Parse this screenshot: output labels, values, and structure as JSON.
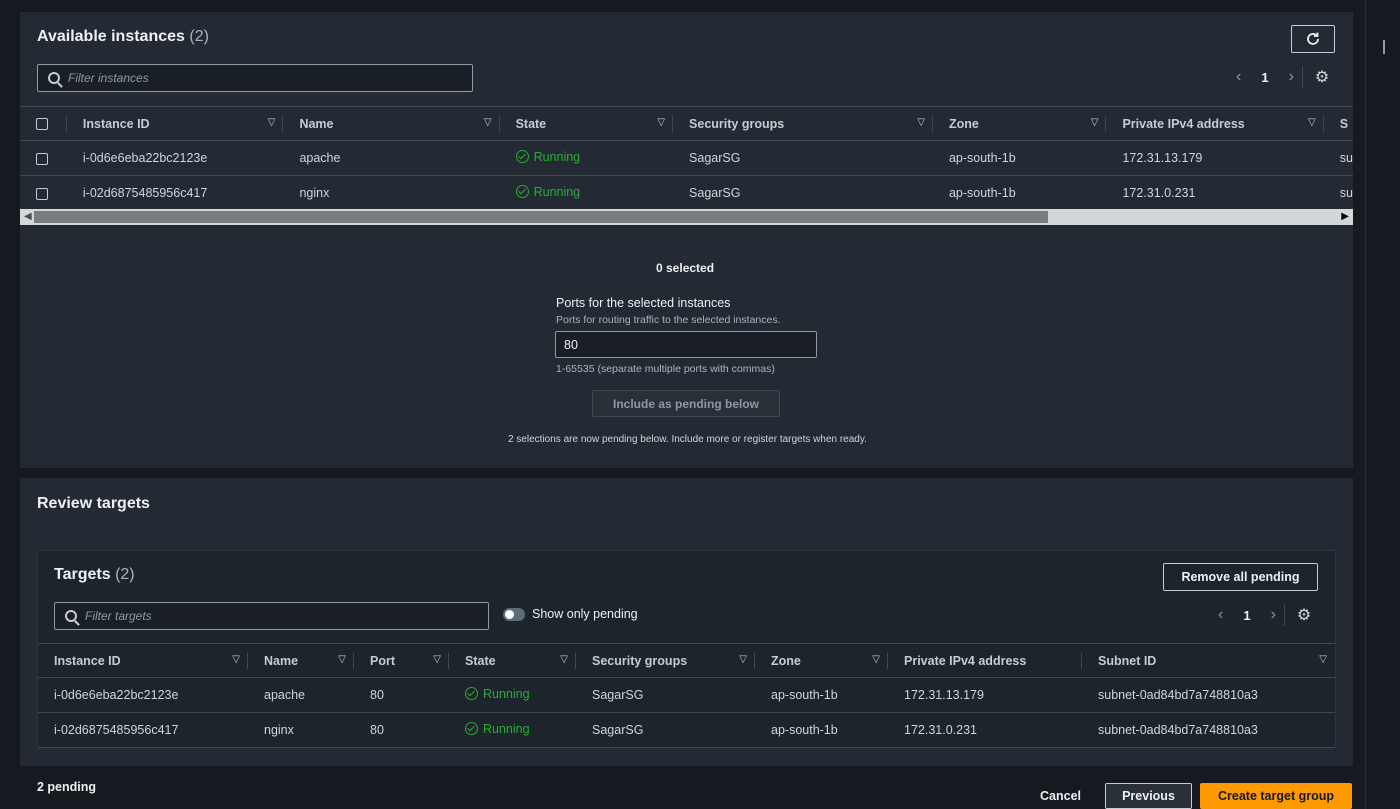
{
  "available": {
    "title": "Available instances",
    "count": "(2)",
    "filter_placeholder": "Filter instances",
    "page": "1",
    "columns": [
      "Instance ID",
      "Name",
      "State",
      "Security groups",
      "Zone",
      "Private IPv4 address",
      "S"
    ],
    "rows": [
      {
        "id": "i-0d6e6eba22bc2123e",
        "name": "apache",
        "state": "Running",
        "sg": "SagarSG",
        "zone": "ap-south-1b",
        "ip": "172.31.13.179",
        "extra": "su"
      },
      {
        "id": "i-02d6875485956c417",
        "name": "nginx",
        "state": "Running",
        "sg": "SagarSG",
        "zone": "ap-south-1b",
        "ip": "172.31.0.231",
        "extra": "su"
      }
    ]
  },
  "selection": {
    "selected_text": "0 selected",
    "ports_label": "Ports for the selected instances",
    "ports_desc": "Ports for routing traffic to the selected instances.",
    "ports_value": "80",
    "ports_hint": "1-65535 (separate multiple ports with commas)",
    "include_button": "Include as pending below",
    "pending_note": "2 selections are now pending below. Include more or register targets when ready."
  },
  "review": {
    "title": "Review targets",
    "targets_title": "Targets",
    "targets_count": "(2)",
    "remove_button": "Remove all pending",
    "filter_placeholder": "Filter targets",
    "toggle_label": "Show only pending",
    "page": "1",
    "columns": [
      "Instance ID",
      "Name",
      "Port",
      "State",
      "Security groups",
      "Zone",
      "Private IPv4 address",
      "Subnet ID"
    ],
    "rows": [
      {
        "id": "i-0d6e6eba22bc2123e",
        "name": "apache",
        "port": "80",
        "state": "Running",
        "sg": "SagarSG",
        "zone": "ap-south-1b",
        "ip": "172.31.13.179",
        "subnet": "subnet-0ad84bd7a748810a3"
      },
      {
        "id": "i-02d6875485956c417",
        "name": "nginx",
        "port": "80",
        "state": "Running",
        "sg": "SagarSG",
        "zone": "ap-south-1b",
        "ip": "172.31.0.231",
        "subnet": "subnet-0ad84bd7a748810a3"
      }
    ]
  },
  "footer": {
    "pending": "2 pending",
    "cancel": "Cancel",
    "previous": "Previous",
    "create": "Create target group"
  },
  "colors": {
    "accent": "#ff9900",
    "running": "#29ad32",
    "panel": "#232a33"
  }
}
